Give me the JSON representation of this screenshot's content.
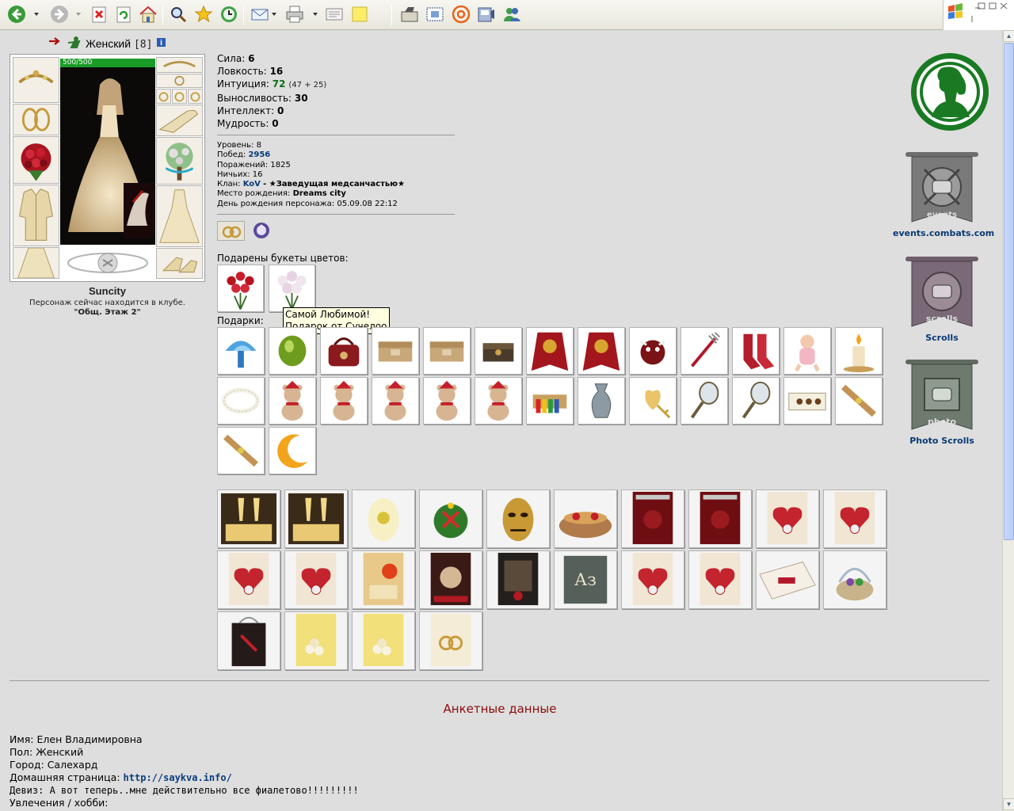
{
  "toolbar": {
    "buttons": [
      "back-icon",
      "forward-icon",
      "stop-icon",
      "refresh-icon",
      "home-icon",
      "search-icon",
      "favorites-icon",
      "history-icon",
      "mail-icon",
      "print-icon",
      "edit-icon",
      "notes-icon",
      "research-icon",
      "screenshot-icon",
      "at-icon",
      "media-icon",
      "messenger-icon"
    ]
  },
  "header": {
    "gender": "Женский",
    "level": "[8]"
  },
  "character": {
    "hp": "500/500",
    "nick": "Suncity",
    "location_line": "Персонаж сейчас находится в клубе.",
    "location_room": "\"Общ. Этаж 2\""
  },
  "stats": {
    "strength_label": "Сила:",
    "strength": "6",
    "agility_label": "Ловкость:",
    "agility": "16",
    "intuition_label": "Интуиция:",
    "intuition": "72",
    "intuition_detail": "(47 + 25)",
    "endurance_label": "Выносливость:",
    "endurance": "30",
    "intellect_label": "Интеллект:",
    "intellect": "0",
    "wisdom_label": "Мудрость:",
    "wisdom": "0"
  },
  "info": {
    "level_label": "Уровень:",
    "level": "8",
    "wins_label": "Побед:",
    "wins": "2956",
    "losses_label": "Поражений:",
    "losses": "1825",
    "draws_label": "Ничьих:",
    "draws": "16",
    "clan_label": "Клан:",
    "clan": "KoV",
    "clan_role": "- ★Заведущая медсанчастью★",
    "birthplace_label": "Место рождения:",
    "birthplace": "Dreams city",
    "birthday_label": "День рождения персонажа:",
    "birthday": "05.09.08 22:12"
  },
  "flowers": {
    "label": "Подарены букеты цветов:",
    "tooltip_line1": "Самой Любимой!",
    "tooltip_line2": "Подарок от Сучелоо"
  },
  "gifts": {
    "label": "Подарки:",
    "items": [
      "crystal-mushroom",
      "green-gem",
      "red-handbag",
      "wooden-box",
      "wooden-box",
      "jewel-casket",
      "red-cloak",
      "red-cloak",
      "bull-toy",
      "red-fork",
      "red-socks",
      "baby-doll",
      "candle",
      "pearl-necklace",
      "teddy-bear",
      "teddy-bear",
      "teddy-bear",
      "teddy-bear",
      "teddy-bear",
      "color-pencils",
      "silver-vase",
      "golden-key-heart",
      "hand-mirror",
      "hand-mirror",
      "chocolate-box",
      "rolling-pin",
      "rolling-pin",
      "crescent-moon"
    ]
  },
  "cards": {
    "items": [
      "champagne-card",
      "champagne-card",
      "yellow-flower-egg",
      "christmas-ball",
      "golden-mask",
      "gift-basket",
      "love-book",
      "love-book",
      "heart-card",
      "heart-card",
      "heart-card",
      "heart-card",
      "balloon-card",
      "fist-poster",
      "combat-card",
      "abc-book",
      "heart-card",
      "heart-card",
      "envelope-card",
      "easter-basket",
      "gift-bag",
      "roses-card",
      "roses-card",
      "rings-card"
    ]
  },
  "banners": {
    "events_caption": "events.combats.com",
    "events_inner": "events",
    "scrolls_caption": "Scrolls",
    "scrolls_inner": "scrolls",
    "photo_caption": "Photo Scrolls",
    "photo_inner": "photo"
  },
  "profile": {
    "title": "Анкетные данные",
    "name_label": "Имя:",
    "name": "Елен Владимировна",
    "gender_label": "Пол:",
    "gender": "Женский",
    "city_label": "Город:",
    "city": "Салехард",
    "homepage_label": "Домашняя страница:",
    "homepage": "http://saykva.info/",
    "motto_label": "Девиз:",
    "motto": "А вот теперь..мне действительно все фиалетово!!!!!!!!!",
    "hobby_label": "Увлечения / хобби:"
  },
  "colors": {
    "background": "#dedede",
    "link": "#0b3a73",
    "accent_green": "#1a7a23",
    "title_red": "#8b0c0c"
  }
}
